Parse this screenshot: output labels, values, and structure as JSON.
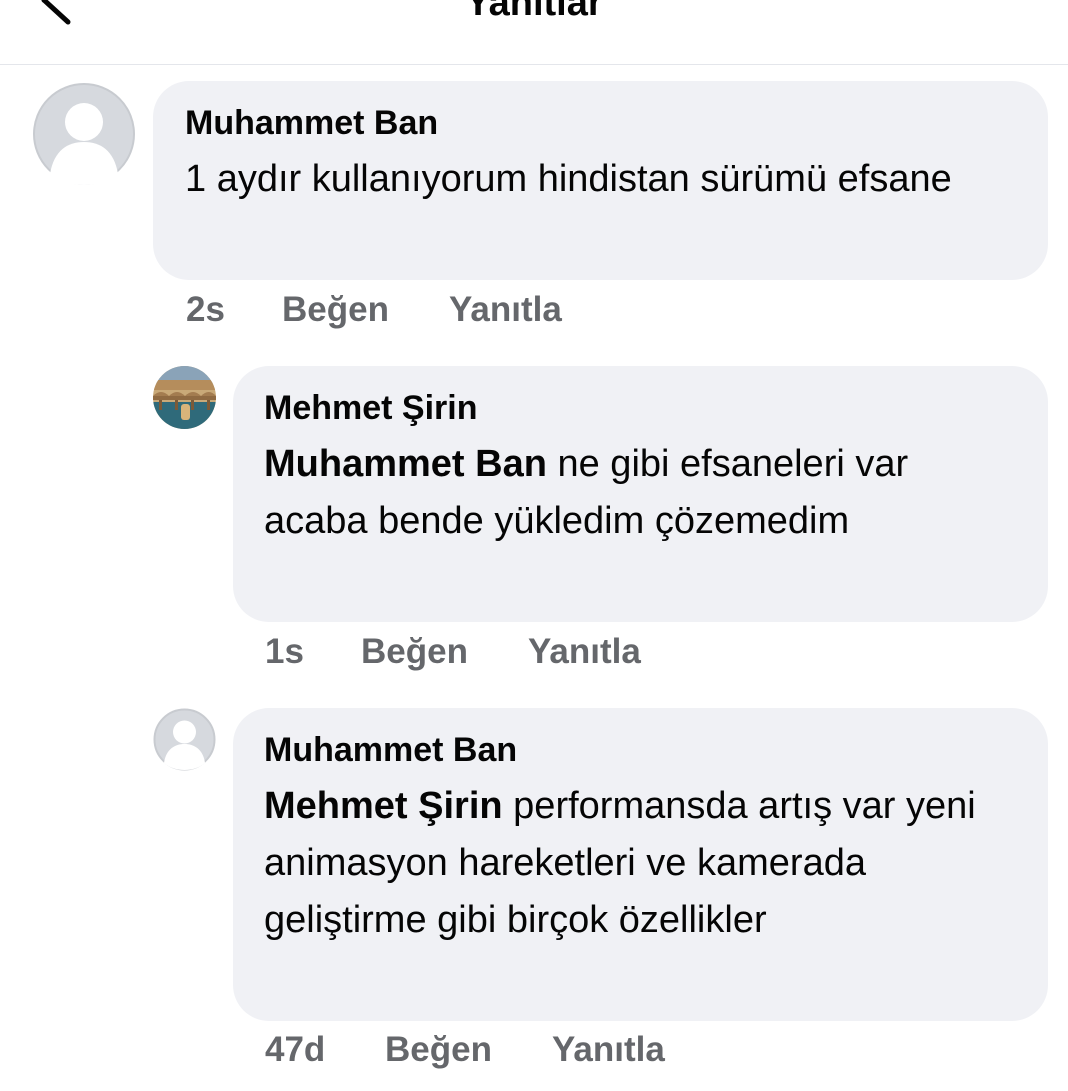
{
  "header": {
    "title": "Yanıtlar"
  },
  "comments": [
    {
      "author": "Muhammet Ban",
      "mention": "",
      "text": "1 aydır kullanıyorum hindistan sürümü efsane",
      "time": "2s",
      "like_label": "Beğen",
      "reply_label": "Yanıtla",
      "avatar": "default-avatar-icon"
    },
    {
      "author": "Mehmet Şirin",
      "mention": "Muhammet Ban",
      "text": "ne gibi efsaneleri var acaba bende yükledim çözemedim",
      "time": "1s",
      "like_label": "Beğen",
      "reply_label": "Yanıtla",
      "avatar": "bridge-photo-avatar"
    },
    {
      "author": "Muhammet Ban",
      "mention": "Mehmet Şirin",
      "text": "performansda artış var yeni animasyon hareketleri ve kamerada geliştirme gibi birçok özellikler",
      "time": "47d",
      "like_label": "Beğen",
      "reply_label": "Yanıtla",
      "avatar": "default-avatar-icon"
    }
  ],
  "colors": {
    "bubble": "#f0f1f5",
    "meta_text": "#65676b",
    "text": "#050505"
  }
}
